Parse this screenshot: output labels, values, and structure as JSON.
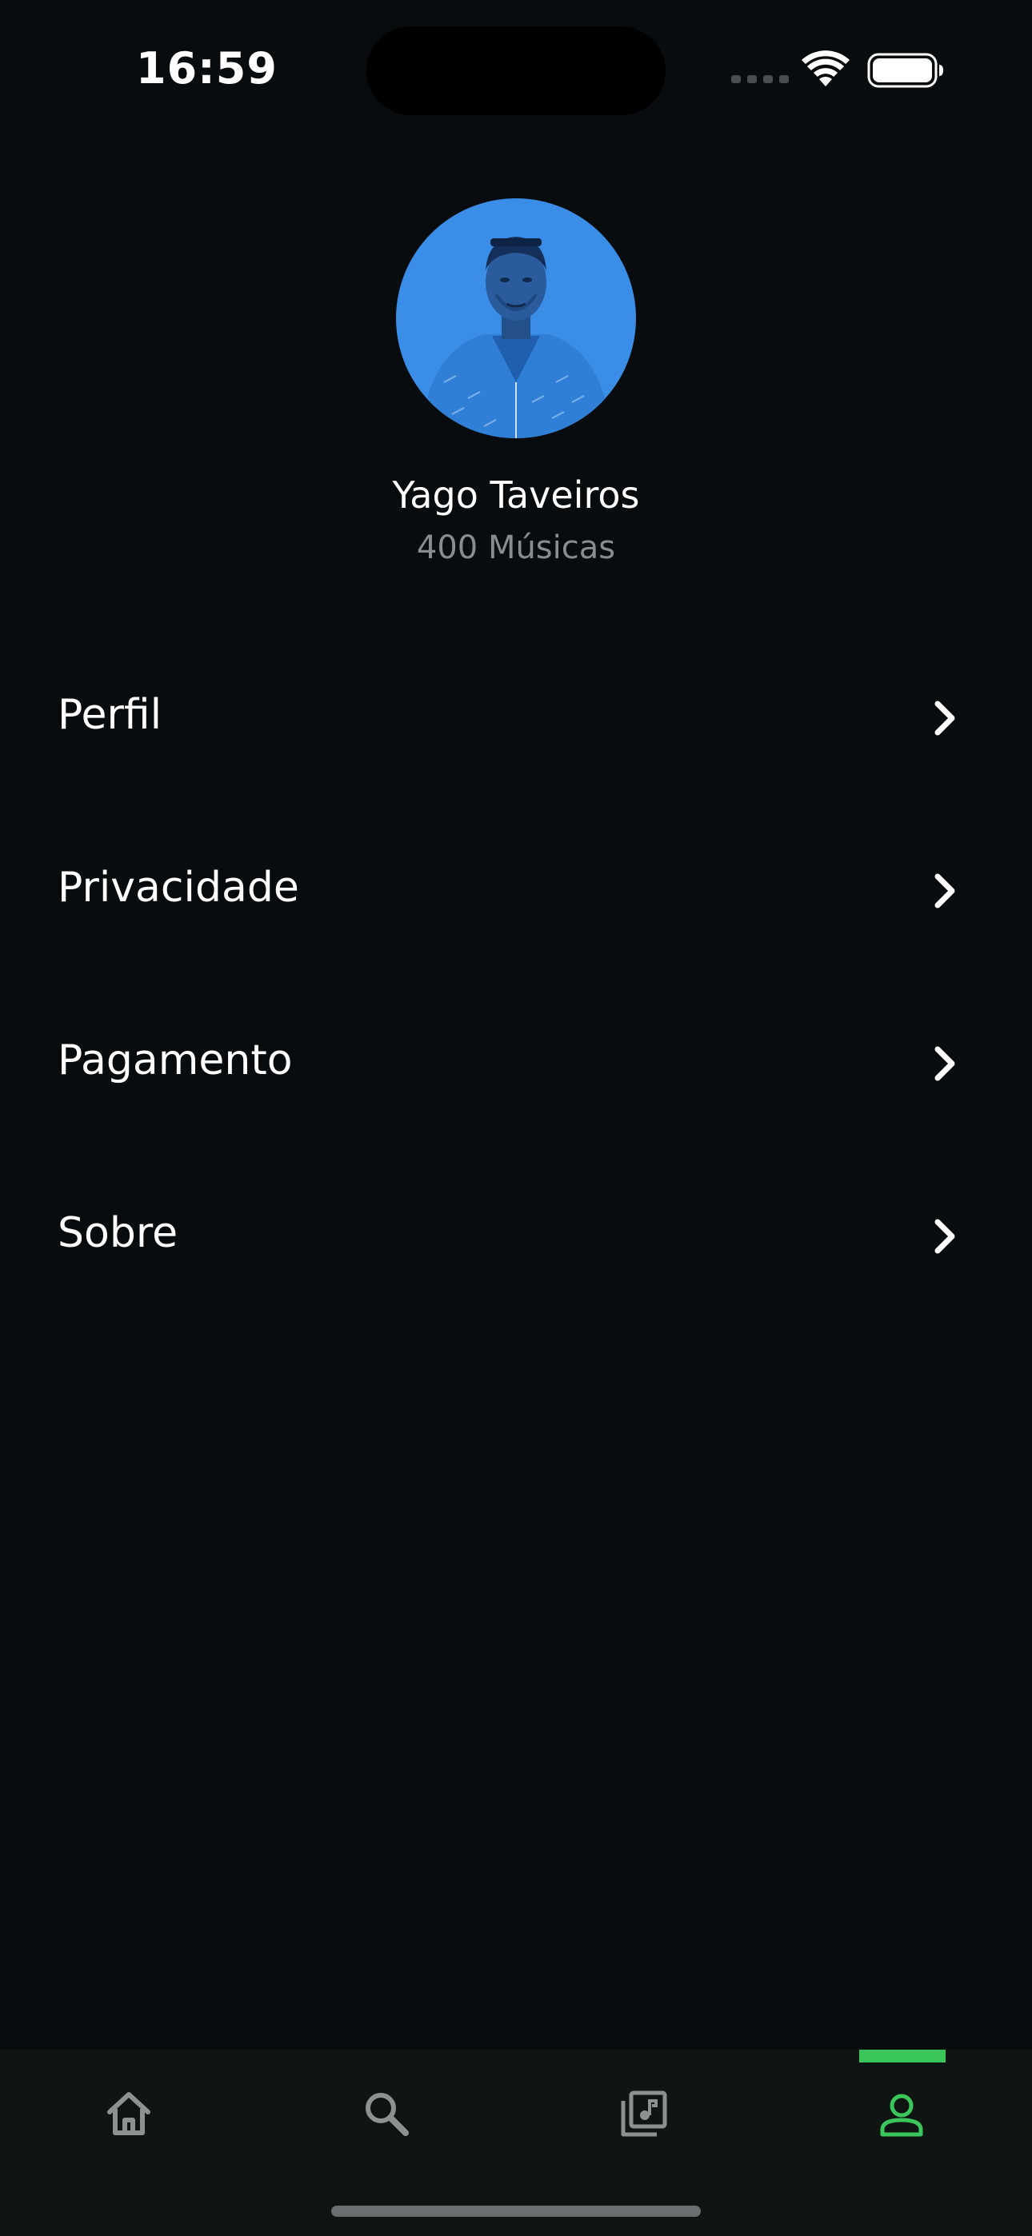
{
  "status_bar": {
    "time": "16:59"
  },
  "profile": {
    "name": "Yago Taveiros",
    "song_count": "400 Músicas"
  },
  "menu": {
    "items": [
      {
        "label": "Perfil",
        "icon": "chevron-right-icon"
      },
      {
        "label": "Privacidade",
        "icon": "chevron-right-icon"
      },
      {
        "label": "Pagamento",
        "icon": "chevron-right-icon"
      },
      {
        "label": "Sobre",
        "icon": "chevron-right-icon"
      }
    ]
  },
  "tab_bar": {
    "tabs": [
      {
        "icon": "home-icon",
        "active": false
      },
      {
        "icon": "search-icon",
        "active": false
      },
      {
        "icon": "library-music-icon",
        "active": false
      },
      {
        "icon": "person-icon",
        "active": true
      }
    ],
    "active_color": "#3bc65b",
    "inactive_color": "#8d918f"
  },
  "colors": {
    "background": "#080c0e",
    "tab_bar_background": "#0f1512",
    "avatar_background": "#3a8ee8",
    "secondary_text": "#8a8d90"
  }
}
